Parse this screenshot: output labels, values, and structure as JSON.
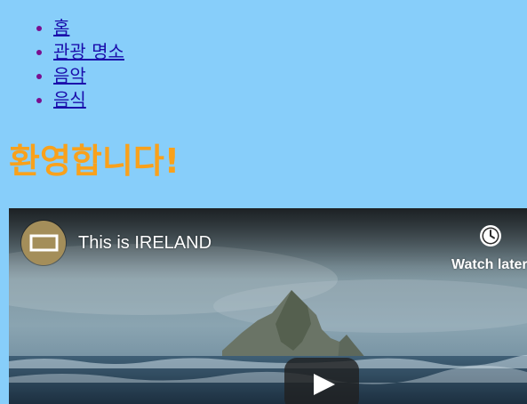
{
  "nav": {
    "items": [
      {
        "label": "홈"
      },
      {
        "label": "관광 명소"
      },
      {
        "label": "음악"
      },
      {
        "label": "음식"
      }
    ]
  },
  "page": {
    "title": "환영합니다!"
  },
  "video": {
    "title": "This is IRELAND",
    "watch_later_label": "Watch later",
    "play_icon": "play-icon",
    "clock_icon": "clock-icon"
  },
  "colors": {
    "background": "#87cefa",
    "title": "#f9a11b",
    "link": "#1a0dab",
    "bullet": "#7a0f8f"
  }
}
